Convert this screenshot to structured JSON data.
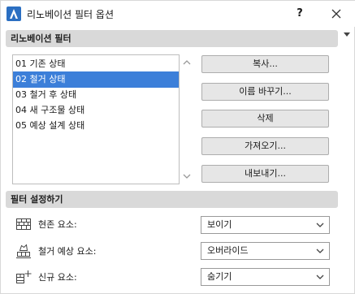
{
  "window": {
    "title": "리노베이션 필터 옵션",
    "help_label": "?",
    "icons": {
      "app": "archicad-logo-icon",
      "close": "close-icon"
    }
  },
  "filters_section": {
    "header": "리노베이션 필터",
    "items": [
      {
        "label": "01 기존 상태"
      },
      {
        "label": "02 철거 상태"
      },
      {
        "label": "03 철거 후 상태"
      },
      {
        "label": "04 새 구조물 상태"
      },
      {
        "label": "05 예상 설계 상태"
      }
    ],
    "selected_index": 1,
    "buttons": {
      "copy": "복사...",
      "rename": "이름 바꾸기...",
      "delete": "삭제",
      "import": "가져오기...",
      "export": "내보내기..."
    }
  },
  "settings_section": {
    "header": "필터 설정하기",
    "rows": [
      {
        "label": "현존 요소:",
        "value": "보이기",
        "icon": "brick-wall-icon"
      },
      {
        "label": "철거 예상 요소:",
        "value": "오버라이드",
        "icon": "demolish-icon"
      },
      {
        "label": "신규 요소:",
        "value": "숨기기",
        "icon": "new-element-icon"
      }
    ]
  },
  "colors": {
    "selection": "#3c7fd9",
    "section_header_bg": "#d9d9d9",
    "button_bg": "#e6e6e6"
  }
}
